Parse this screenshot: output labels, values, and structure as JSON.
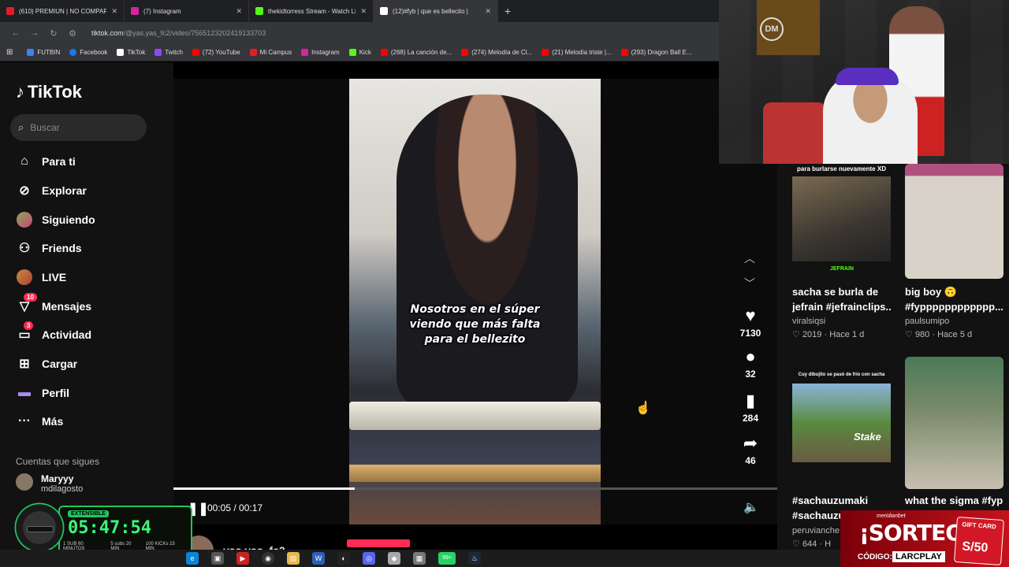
{
  "browser": {
    "tabs": [
      {
        "label": "(610) PREMIUN | NO COMPARTI",
        "favicon_color": "#e11d2a"
      },
      {
        "label": "(7) Instagram",
        "favicon_color": "#d6249f"
      },
      {
        "label": "thekidtorress Stream - Watch Li",
        "favicon_color": "#53fc18"
      },
      {
        "label": "(12)#fyb | que es bellecito |",
        "favicon_color": "#ffffff",
        "active": true
      }
    ],
    "url_host": "tiktok.com",
    "url_path": "/@yas.yas_fc2/video/7565123202419133703",
    "bookmarks": [
      {
        "label": "FUTBIN",
        "color": "#3b82f6"
      },
      {
        "label": "Facebook",
        "color": "#1877f2"
      },
      {
        "label": "TikTok",
        "color": "#ffffff"
      },
      {
        "label": "Twitch",
        "color": "#9146ff"
      },
      {
        "label": "(72) YouTube",
        "color": "#ff0000"
      },
      {
        "label": "Mi Campus",
        "color": "#e11d2a"
      },
      {
        "label": "Instagram",
        "color": "#d6249f"
      },
      {
        "label": "Kick",
        "color": "#53fc18"
      },
      {
        "label": "(268) La canción de...",
        "color": "#ff0000"
      },
      {
        "label": "(274) Melodía de Cl...",
        "color": "#ff0000"
      },
      {
        "label": "(21) Melodía triste |...",
        "color": "#ff0000"
      },
      {
        "label": "(293) Dragon Ball E...",
        "color": "#ff0000"
      }
    ]
  },
  "sidebar": {
    "logo": "TikTok",
    "search_placeholder": "Buscar",
    "items": [
      {
        "label": "Para ti",
        "icon": "home-icon"
      },
      {
        "label": "Explorar",
        "icon": "compass-icon"
      },
      {
        "label": "Siguiendo",
        "icon": "following-icon"
      },
      {
        "label": "Friends",
        "icon": "friends-icon"
      },
      {
        "label": "LIVE",
        "icon": "live-icon"
      },
      {
        "label": "Mensajes",
        "icon": "messages-icon",
        "badge": "10"
      },
      {
        "label": "Actividad",
        "icon": "activity-icon",
        "badge": "3"
      },
      {
        "label": "Cargar",
        "icon": "upload-icon"
      },
      {
        "label": "Perfil",
        "icon": "profile-icon"
      },
      {
        "label": "Más",
        "icon": "more-icon"
      }
    ],
    "following_title": "Cuentas que sigues",
    "following": {
      "name": "Maryyy",
      "handle": "mdilagosto"
    }
  },
  "video": {
    "caption_line1": "Nosotros en el súper",
    "caption_line2": "viendo que más falta",
    "caption_line3": "para el bellezito",
    "time": "00:05 / 00:17",
    "progress": 0.3,
    "author": "yas.yas_fc2"
  },
  "actions": {
    "likes": "7130",
    "comments": "32",
    "saves": "284",
    "shares": "46"
  },
  "recommendations": [
    {
      "thumb_text": "para burlarse nuevamente XD",
      "badge": "JEFRAIN",
      "title_line1": "sacha se burla de",
      "title_line2": "jefrain #jefrainclips...",
      "user": "viralsiqsi",
      "likes": "2019",
      "age": "Hace 1 d"
    },
    {
      "title_line1": "big boy 🙃",
      "title_line2": "#fypppppppppppp...",
      "user": "paulsumipo",
      "likes": "980",
      "age": "Hace 5 d"
    },
    {
      "thumb_text": "Cuy dibujito se pasó de frío con sacha",
      "badge": "Stake",
      "title_line1": "#sachauzumaki",
      "title_line2": "#sachauzu",
      "user": "peruvianche",
      "likes": "644",
      "age": "H"
    },
    {
      "title_line1": "what the sigma #fyp",
      "title_line2": "",
      "user": "",
      "likes": "",
      "age": ""
    }
  ],
  "timer_overlay": {
    "tag": "EXTENSIBLE",
    "time": "05:47:54",
    "sub1": "1 SUB 60 MINUTOS",
    "sub2": "5 subs 20 MIN",
    "sub3": "100 KICKs 15 MIN"
  },
  "promo": {
    "brand": "meridianbet",
    "headline": "¡SORTEO!",
    "code_label": "CÓDIGO:",
    "code": "LARCPLAY",
    "card_label": "GIFT CARD",
    "card_amount": "S/50"
  },
  "taskbar_badge": "99+"
}
